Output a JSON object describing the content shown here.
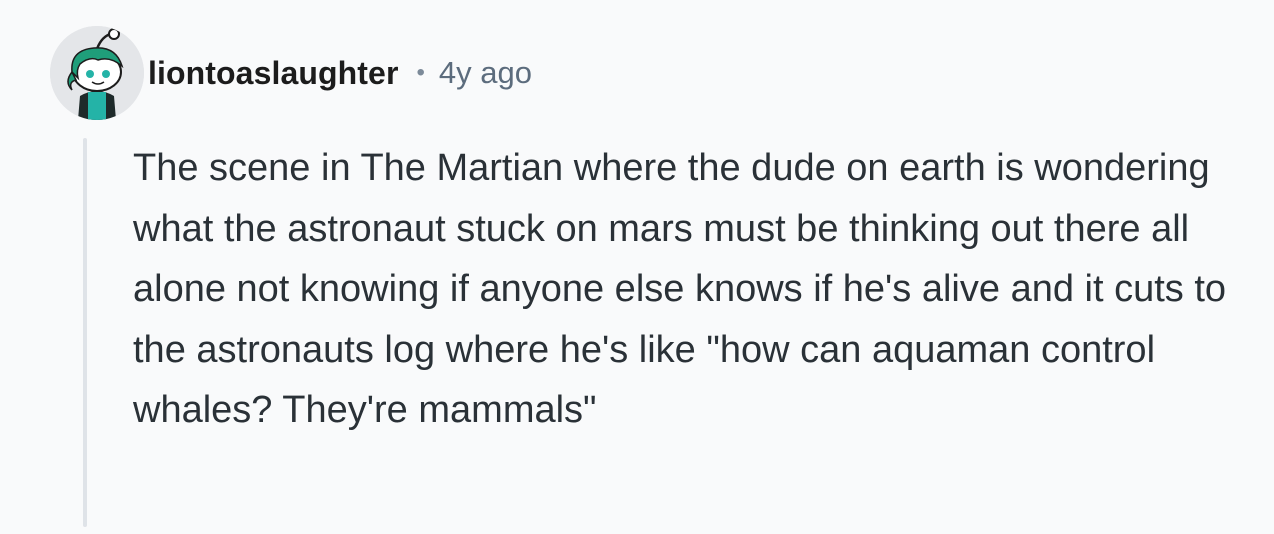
{
  "comment": {
    "username": "liontoaslaughter",
    "separator": "•",
    "timestamp": "4y ago",
    "avatar_icon": "snoo-avatar-icon",
    "body": "The scene in The Martian where the dude on earth is wondering what the astronaut stuck on mars must be thinking out there all alone not knowing if anyone else knows if he's alive and it cuts to the astronauts log where he's like \"how can aquaman control whales? They're mammals\""
  },
  "colors": {
    "background": "#f9fafb",
    "thread_line": "#dfe3e8",
    "avatar_hair": "#1f9e7a",
    "avatar_face": "#ffffff",
    "timestamp": "#5c6c7d"
  }
}
